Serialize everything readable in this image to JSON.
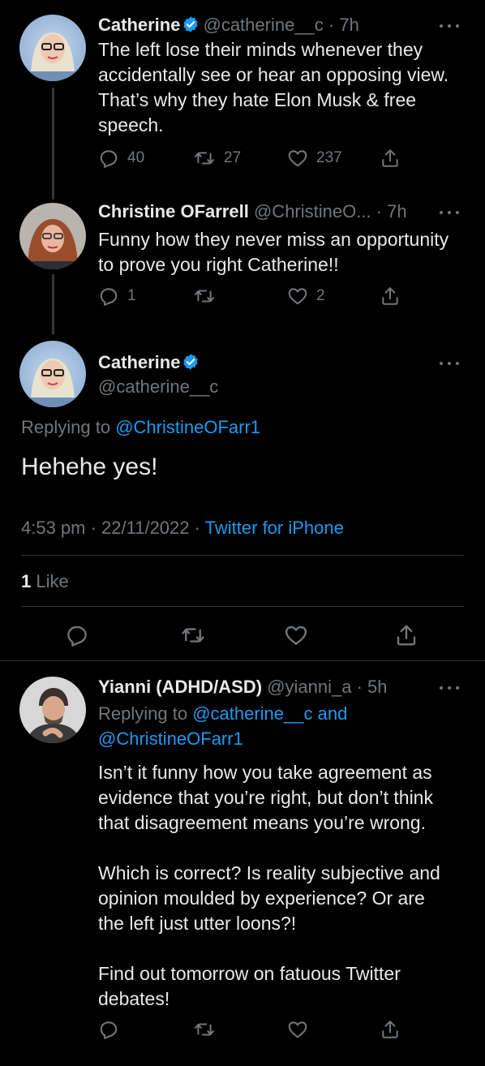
{
  "tweets": [
    {
      "name": "Catherine",
      "handle_time": "@catherine__c · 7h",
      "text_lines": [
        "The left lose their minds whenever they",
        "accidentally see or hear an opposing view.",
        "That’s why they hate Elon Musk & free",
        "speech."
      ],
      "replies": "40",
      "retweets": "27",
      "likes": "237"
    },
    {
      "name": "Christine OFarrell",
      "handle_time": "@ChristineO... · 7h",
      "text_lines": [
        "Funny how they never miss an opportunity",
        "to prove you right Catherine!!"
      ],
      "replies": "1",
      "retweets": "",
      "likes": "2"
    }
  ],
  "focus": {
    "name": "Catherine",
    "handle": "@catherine__c",
    "replying_prefix": "Replying to ",
    "replying_to": "@ChristineOFarr1",
    "text": "Hehehe yes!",
    "timestamp": "4:53 pm · 22/11/2022 · ",
    "source": "Twitter for iPhone",
    "likes_count": "1",
    "likes_label": " Like"
  },
  "reply": {
    "name": "Yianni (ADHD/ASD)",
    "handle_time": "@yianni_a · 5h",
    "replying_prefix": "Replying to ",
    "replying_to_1": "@catherine__c",
    "replying_and": " and",
    "replying_to_2": "@ChristineOFarr1",
    "para1": [
      "Isn’t it funny how you take agreement as",
      "evidence that you’re right, but don’t think",
      "that disagreement means you’re wrong."
    ],
    "para2": [
      "Which is correct? Is reality subjective and",
      "opinion moulded by experience? Or are",
      "the left just utter loons?!"
    ],
    "para3": [
      "Find out tomorrow on fatuous Twitter",
      "debates!"
    ]
  },
  "colors": {
    "background": "#000000",
    "text": "#e7e9ea",
    "muted": "#71767b",
    "link": "#1d9bf0",
    "verified": "#1d9bf0"
  },
  "icons": [
    "reply-icon",
    "retweet-icon",
    "like-icon",
    "share-icon",
    "verified-badge-icon",
    "more-icon"
  ]
}
